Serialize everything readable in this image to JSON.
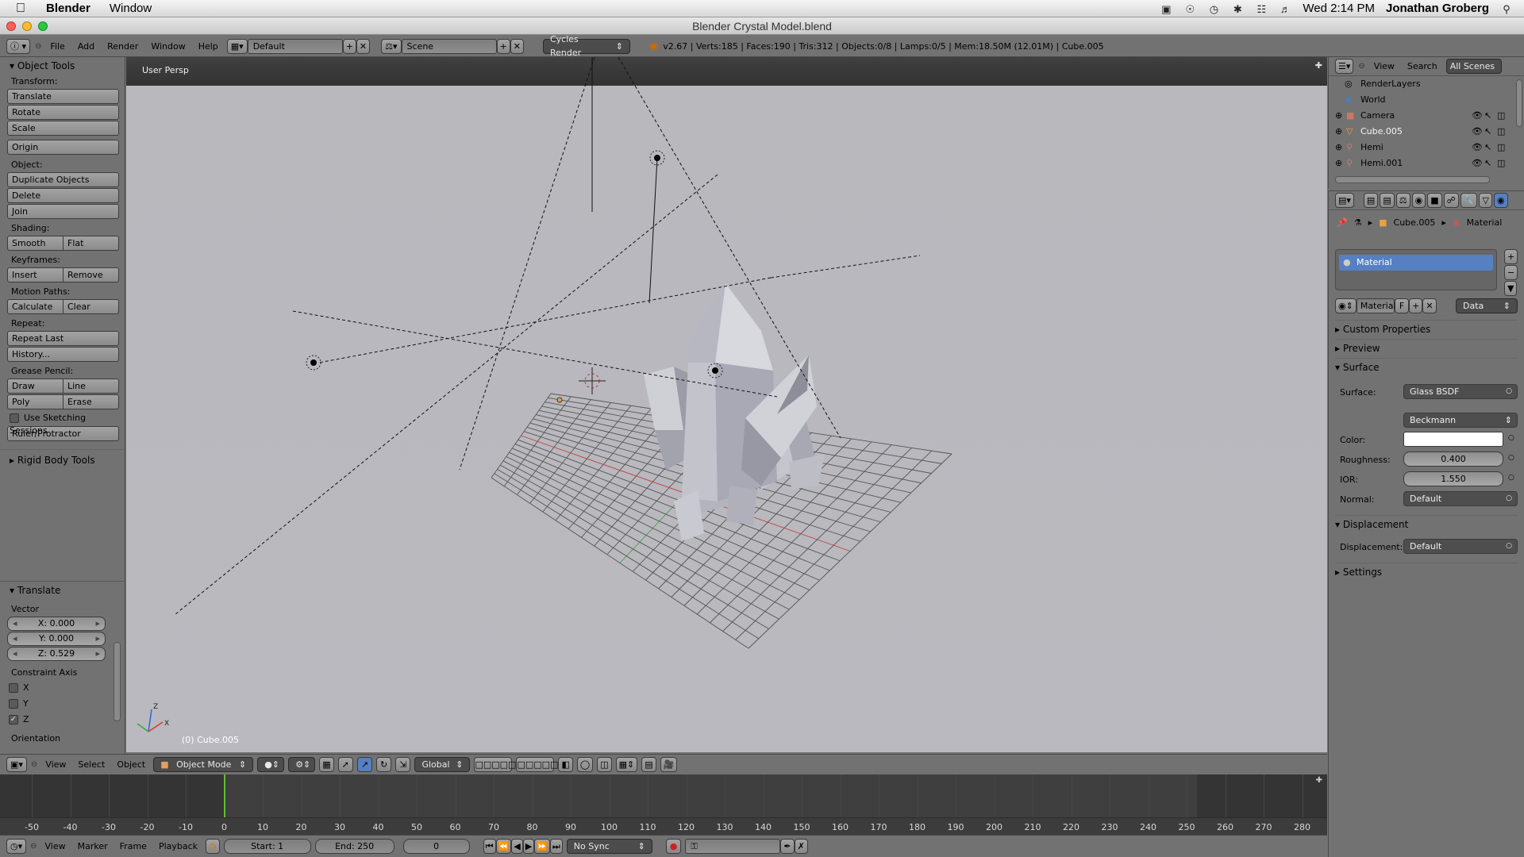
{
  "macbar": {
    "app_name": "Blender",
    "menu_window": "Window",
    "clock": "Wed 2:14 PM",
    "user": "Jonathan Groberg"
  },
  "window": {
    "title": "Blender Crystal Model.blend"
  },
  "info_header": {
    "menus": [
      "File",
      "Add",
      "Render",
      "Window",
      "Help"
    ],
    "layout": "Default",
    "scene": "Scene",
    "engine": "Cycles Render",
    "stats": "v2.67 | Verts:185 | Faces:190 | Tris:312 | Objects:0/8 | Lamps:0/5 | Mem:18.50M (12.01M) | Cube.005"
  },
  "tool_shelf": {
    "title": "Object Tools",
    "transform_label": "Transform:",
    "translate": "Translate",
    "rotate": "Rotate",
    "scale": "Scale",
    "origin": "Origin",
    "object_label": "Object:",
    "duplicate": "Duplicate Objects",
    "delete": "Delete",
    "join": "Join",
    "shading_label": "Shading:",
    "smooth": "Smooth",
    "flat": "Flat",
    "keyframes_label": "Keyframes:",
    "insert": "Insert",
    "remove": "Remove",
    "motion_label": "Motion Paths:",
    "calculate": "Calculate",
    "clear": "Clear",
    "repeat_label": "Repeat:",
    "repeat_last": "Repeat Last",
    "history": "History...",
    "grease_label": "Grease Pencil:",
    "draw": "Draw",
    "line": "Line",
    "poly": "Poly",
    "erase": "Erase",
    "sketching": "Use Sketching Sessions",
    "ruler": "Ruler/Protractor",
    "rigid_body": "Rigid Body Tools"
  },
  "operator_panel": {
    "title": "Translate",
    "vector_label": "Vector",
    "x": "X: 0.000",
    "y": "Y: 0.000",
    "z": "Z: 0.529",
    "constraint_label": "Constraint Axis",
    "axis_x": "X",
    "axis_y": "Y",
    "axis_z": "Z",
    "axis_z_checked": true,
    "orientation_label": "Orientation"
  },
  "viewport": {
    "view_label": "User Persp",
    "object_label": "(0) Cube.005",
    "axis_z": "Z",
    "axis_x": "X"
  },
  "view3d_header": {
    "view": "View",
    "select": "Select",
    "object": "Object",
    "mode": "Object Mode",
    "orientation": "Global"
  },
  "timeline": {
    "ticks": [
      "-50",
      "-40",
      "-30",
      "-20",
      "-10",
      "0",
      "10",
      "20",
      "30",
      "40",
      "50",
      "60",
      "70",
      "80",
      "90",
      "100",
      "110",
      "120",
      "130",
      "140",
      "150",
      "160",
      "170",
      "180",
      "190",
      "200",
      "210",
      "220",
      "230",
      "240",
      "250",
      "260",
      "270",
      "280"
    ],
    "current_frame": 0,
    "view": "View",
    "marker": "Marker",
    "frame": "Frame",
    "playback": "Playback",
    "start": "Start: 1",
    "end": "End: 250",
    "frame_value": "0",
    "sync": "No Sync"
  },
  "outliner": {
    "view": "View",
    "search": "Search",
    "filter": "All Scenes",
    "items": [
      "RenderLayers",
      "World",
      "Camera",
      "Cube.005",
      "Hemi",
      "Hemi.001"
    ]
  },
  "properties": {
    "breadcrumb_object": "Cube.005",
    "breadcrumb_material": "Material",
    "slot_name": "Material",
    "material_name": "Material",
    "f_label": "F",
    "data_link": "Data",
    "custom_properties": "Custom Properties",
    "preview": "Preview",
    "surface_section": "Surface",
    "surface_label": "Surface:",
    "surface_value": "Glass BSDF",
    "distribution": "Beckmann",
    "color_label": "Color:",
    "color_value": "#ffffff",
    "roughness_label": "Roughness:",
    "roughness": "0.400",
    "ior_label": "IOR:",
    "ior": "1.550",
    "normal_label": "Normal:",
    "normal": "Default",
    "displacement_section": "Displacement",
    "displacement_label": "Displacement:",
    "displacement_value": "Default",
    "settings": "Settings"
  },
  "colors": {
    "panel_bg": "#727272",
    "viewport_bg": "#b8b8bd",
    "selected_slot": "#5680c2",
    "grid_line": "#555555",
    "axis_x": "#c04040",
    "axis_y": "#40a040",
    "frame_cursor": "#60c030"
  }
}
